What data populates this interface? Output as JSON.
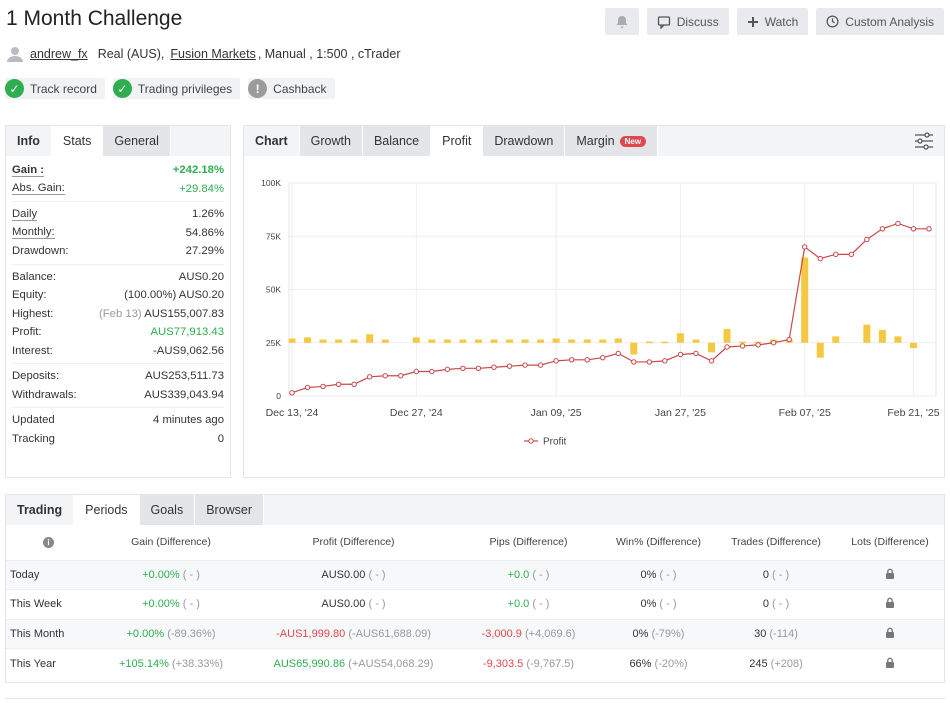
{
  "header": {
    "title": "1 Month Challenge",
    "actions": [
      "Discuss",
      "Watch",
      "Custom Analysis"
    ]
  },
  "account": {
    "user": "andrew_fx",
    "type": "Real (AUS),",
    "broker": "Fusion Markets",
    "details": ", Manual , 1:500 , cTrader"
  },
  "badges": [
    {
      "label": "Track record",
      "status": "verified"
    },
    {
      "label": "Trading privileges",
      "status": "verified"
    },
    {
      "label": "Cashback",
      "status": "info"
    }
  ],
  "left_tabs": [
    "Info",
    "Stats",
    "General"
  ],
  "stats": {
    "gain": {
      "label": "Gain :",
      "value": "+242.18%"
    },
    "abs_gain": {
      "label": "Abs. Gain:",
      "value": "+29.84%"
    },
    "daily": {
      "label": "Daily",
      "value": "1.26%"
    },
    "monthly": {
      "label": "Monthly:",
      "value": "54.86%"
    },
    "drawdown": {
      "label": "Drawdown:",
      "value": "27.29%"
    },
    "balance": {
      "label": "Balance:",
      "value": "AUS0.20"
    },
    "equity": {
      "label": "Equity:",
      "pct": "(100.00%)",
      "value": "AUS0.20"
    },
    "highest": {
      "label": "Highest:",
      "date": "(Feb 13)",
      "value": "AUS155,007.83"
    },
    "profit": {
      "label": "Profit:",
      "value": "AUS77,913.43"
    },
    "interest": {
      "label": "Interest:",
      "value": "-AUS9,062.56"
    },
    "deposits": {
      "label": "Deposits:",
      "value": "AUS253,511.73"
    },
    "withdrawals": {
      "label": "Withdrawals:",
      "value": "AUS339,043.94"
    },
    "updated": {
      "label": "Updated",
      "value": "4 minutes ago"
    },
    "tracking": {
      "label": "Tracking",
      "value": "0"
    }
  },
  "chart_tabs": [
    "Chart",
    "Growth",
    "Balance",
    "Profit",
    "Drawdown",
    "Margin"
  ],
  "chart_new_badge": "New",
  "chart_data": {
    "type": "line",
    "ylim": [
      0,
      100000
    ],
    "yticks": [
      "0",
      "25K",
      "50K",
      "75K",
      "100K"
    ],
    "xticks": [
      "Dec 13, '24",
      "Dec 27, '24",
      "Jan 09, '25",
      "Jan 27, '25",
      "Feb 07, '25",
      "Feb 21, '25"
    ],
    "legend": "Profit",
    "colors": {
      "line": "#c94848",
      "bars": "#f5c842"
    },
    "series": [
      {
        "name": "Profit",
        "values": [
          1500,
          4000,
          4500,
          5500,
          5500,
          9000,
          9500,
          9500,
          11500,
          11500,
          12500,
          13000,
          13000,
          13500,
          14000,
          14500,
          14500,
          16500,
          17000,
          17000,
          18000,
          20000,
          16000,
          16000,
          16500,
          19500,
          20000,
          16500,
          23000,
          23500,
          24000,
          25000,
          26500,
          70000,
          64500,
          66500,
          66500,
          73500,
          78500,
          81000,
          78500,
          78500
        ]
      }
    ],
    "bars": [
      2000,
      2500,
      1500,
      1500,
      1500,
      4000,
      1500,
      0,
      2500,
      1500,
      1500,
      1500,
      1500,
      1500,
      1500,
      1500,
      1500,
      2000,
      1500,
      1500,
      1500,
      2000,
      -5500,
      500,
      500,
      4500,
      1500,
      -4500,
      6500,
      500,
      500,
      1500,
      1500,
      40000,
      -7000,
      3000,
      0,
      8500,
      6000,
      3000,
      -2500,
      0
    ]
  },
  "bottom_tabs": [
    "Trading",
    "Periods",
    "Goals",
    "Browser"
  ],
  "periods": {
    "headers": [
      "Gain (Difference)",
      "Profit (Difference)",
      "Pips (Difference)",
      "Win% (Difference)",
      "Trades (Difference)",
      "Lots (Difference)"
    ],
    "rows": [
      {
        "period": "Today",
        "gain": "+0.00%",
        "gain_diff": "( - )",
        "profit": "AUS0.00",
        "profit_diff": "( - )",
        "pips": "+0.0",
        "pips_diff": "( - )",
        "win": "0%",
        "win_diff": "( - )",
        "trades": "0",
        "trades_diff": "( - )"
      },
      {
        "period": "This Week",
        "gain": "+0.00%",
        "gain_diff": "( - )",
        "profit": "AUS0.00",
        "profit_diff": "( - )",
        "pips": "+0.0",
        "pips_diff": "( - )",
        "win": "0%",
        "win_diff": "( - )",
        "trades": "0",
        "trades_diff": "( - )"
      },
      {
        "period": "This Month",
        "gain": "+0.00%",
        "gain_diff": "(-89.36%)",
        "profit": "-AUS1,999.80",
        "profit_diff": "(-AUS61,688.09)",
        "pips": "-3,000.9",
        "pips_diff": "(+4,069.6)",
        "win": "0%",
        "win_diff": "(-79%)",
        "trades": "30",
        "trades_diff": "(-114)"
      },
      {
        "period": "This Year",
        "gain": "+105.14%",
        "gain_diff": "(+38.33%)",
        "profit": "AUS65,990.86",
        "profit_diff": "(+AUS54,068.29)",
        "pips": "-9,303.5",
        "pips_diff": "(-9,767.5)",
        "win": "66%",
        "win_diff": "(-20%)",
        "trades": "245",
        "trades_diff": "(+208)"
      }
    ]
  }
}
